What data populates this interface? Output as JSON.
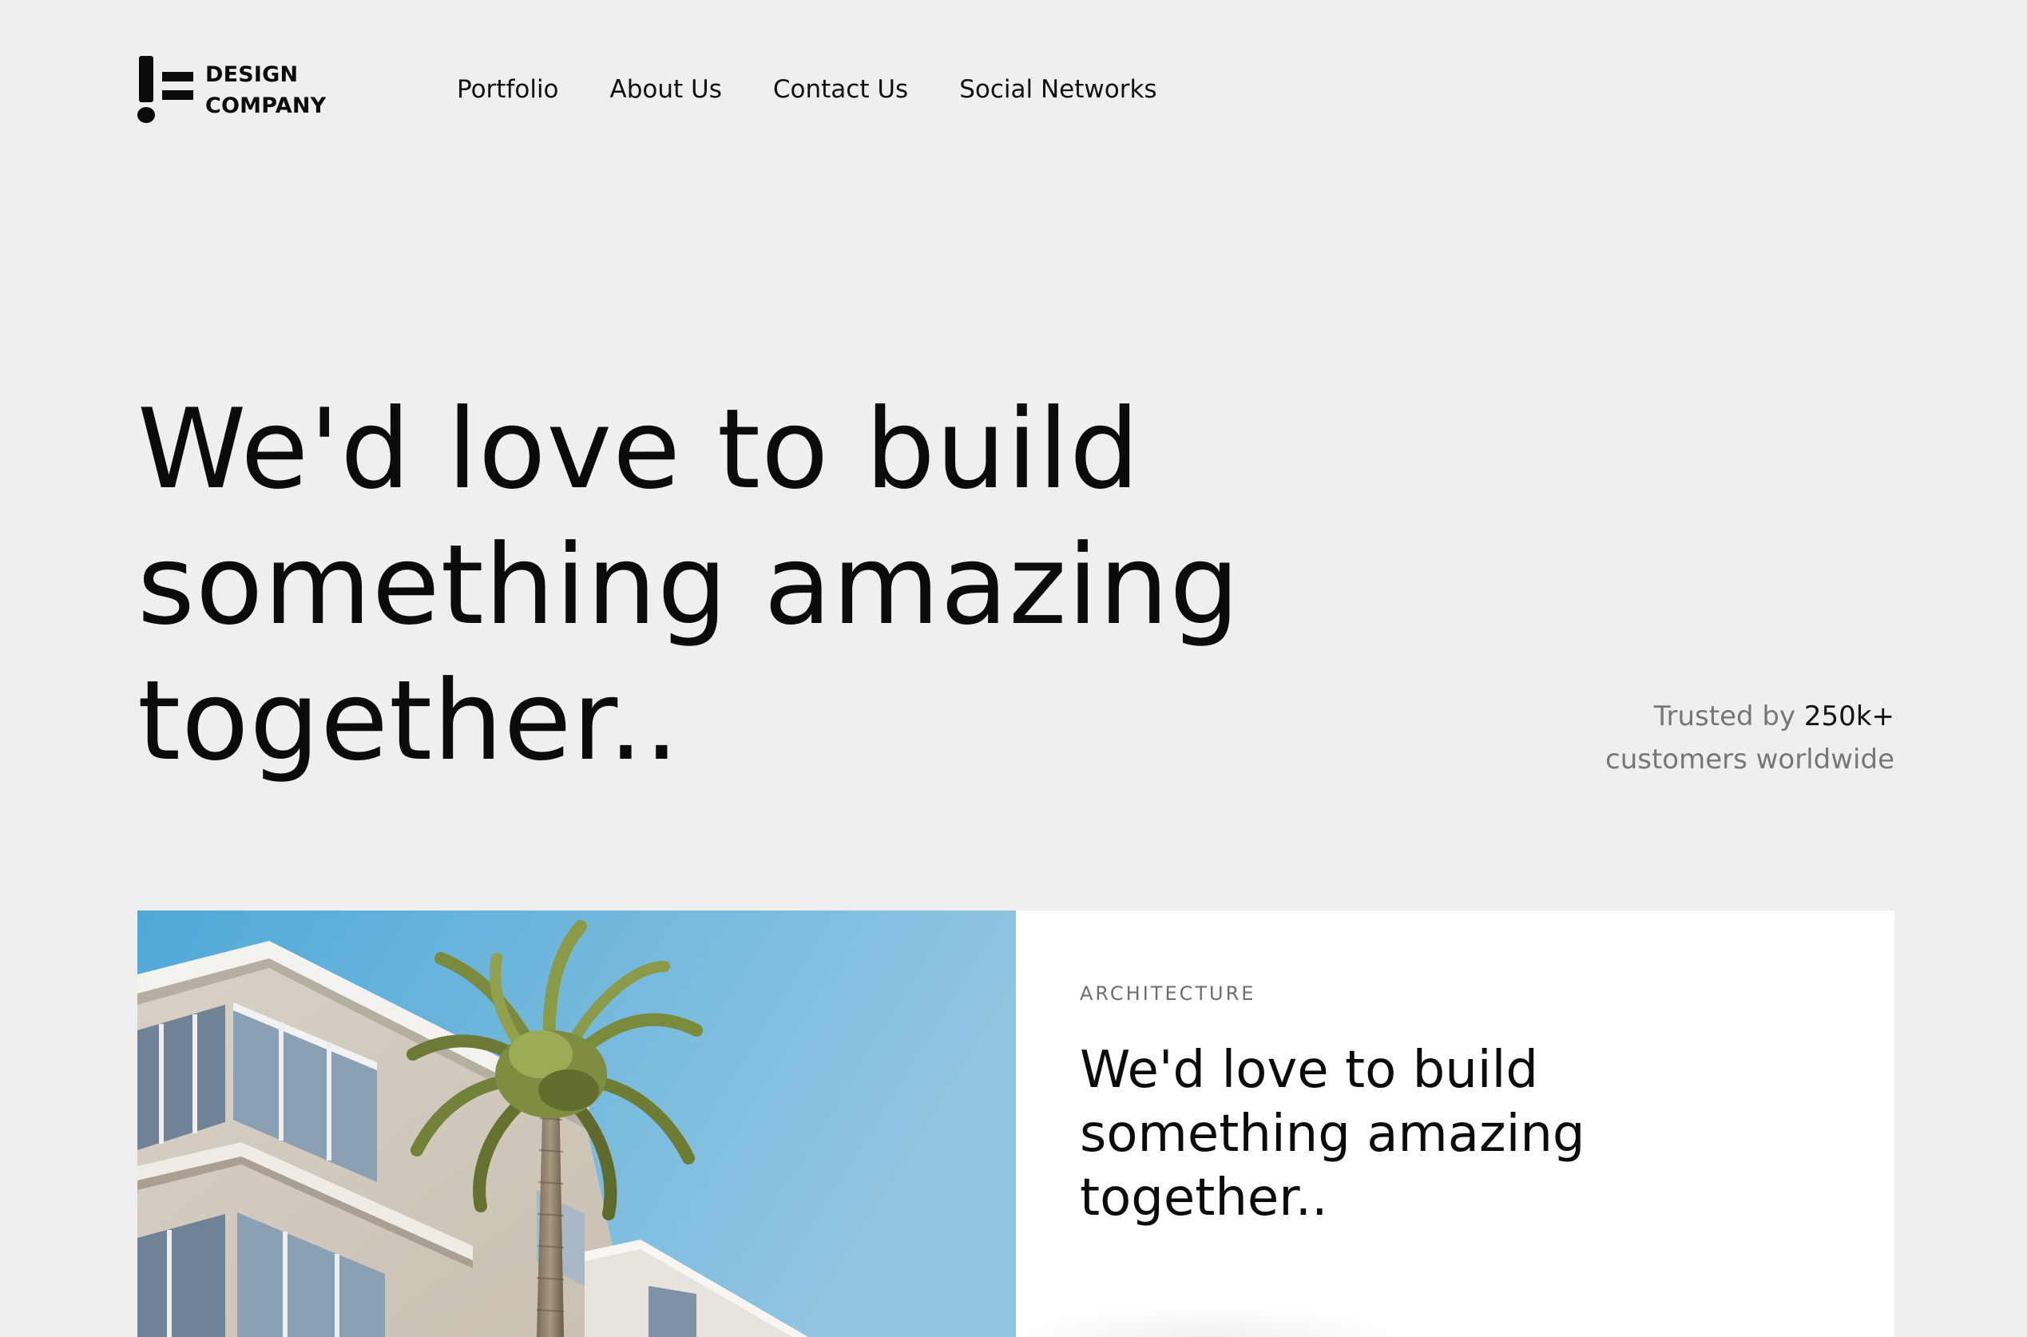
{
  "header": {
    "logo": {
      "line1": "DESIGN",
      "line2": "COMPANY"
    },
    "nav": [
      {
        "label": "Portfolio"
      },
      {
        "label": "About Us"
      },
      {
        "label": "Contact Us"
      },
      {
        "label": "Social Networks"
      }
    ]
  },
  "hero": {
    "title_lines": [
      "We'd love to build",
      "something amazing",
      "together.."
    ],
    "trusted": {
      "prefix": "Trusted by",
      "count": "250k+",
      "suffix": "customers worldwide"
    }
  },
  "card": {
    "category": "ARCHITECTURE",
    "title_lines": [
      "We'd love to build",
      "something amazing",
      "together.."
    ],
    "image": "building-with-palm-tree"
  },
  "colors": {
    "background": "#efefef",
    "text": "#0b0b0b",
    "muted": "#777777",
    "card": "#ffffff",
    "sky": "#6fb6dd"
  }
}
